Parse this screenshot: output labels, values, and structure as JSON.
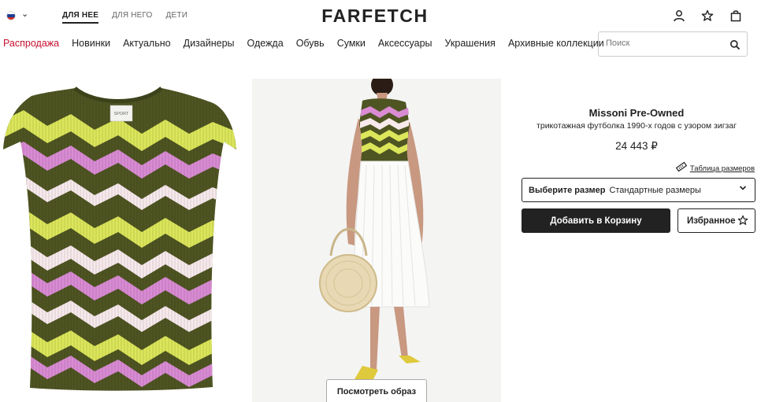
{
  "header": {
    "logo": "FARFETCH",
    "gender_tabs": [
      {
        "label": "ДЛЯ НЕЕ",
        "active": true
      },
      {
        "label": "ДЛЯ НЕГО",
        "active": false
      },
      {
        "label": "ДЕТИ",
        "active": false
      }
    ],
    "icons": [
      "account-icon",
      "wishlist-star-icon",
      "shopping-bag-icon"
    ],
    "flag_colors": [
      "#ffffff",
      "#1c3f94",
      "#d52b1e"
    ]
  },
  "categories": [
    {
      "label": "Распродажа",
      "sale": true
    },
    {
      "label": "Новинки"
    },
    {
      "label": "Актуально"
    },
    {
      "label": "Дизайнеры"
    },
    {
      "label": "Одежда"
    },
    {
      "label": "Обувь"
    },
    {
      "label": "Сумки"
    },
    {
      "label": "Аксессуары"
    },
    {
      "label": "Украшения"
    },
    {
      "label": "Архивные коллекции"
    }
  ],
  "search": {
    "placeholder": "Поиск",
    "value": ""
  },
  "gallery": {
    "look_button": "Посмотреть образ",
    "tag_text": "SPORT"
  },
  "product": {
    "brand": "Missoni Pre-Owned",
    "description": "трикотажная футболка 1990-х годов с узором зигзаг",
    "price": "24 443 ₽",
    "size_guide": "Таблица размеров",
    "size_label": "Выберите размер",
    "size_value": "Стандартные размеры",
    "add_to_cart": "Добавить в Корзину",
    "wishlist": "Избранное"
  },
  "colors": {
    "sale": "#c5112f",
    "primary": "#222222",
    "olive": "#4e5422",
    "pink": "#d98bd3",
    "yellow": "#dbe65a",
    "cream": "#f7e9ec"
  }
}
